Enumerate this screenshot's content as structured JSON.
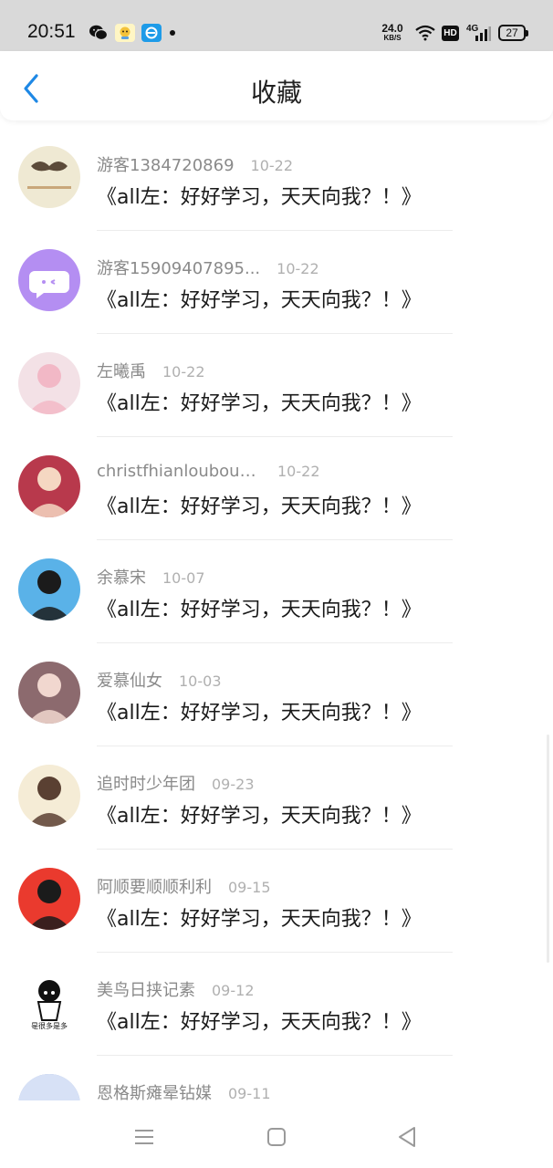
{
  "status_bar": {
    "time": "20:51",
    "net_speed_value": "24.0",
    "net_speed_unit": "KB/S",
    "hd_label": "HD",
    "network_label": "4G",
    "battery": "27",
    "notification_icons": [
      "wechat-icon",
      "contact-app-icon",
      "browser-app-icon"
    ]
  },
  "header": {
    "title": "收藏"
  },
  "favorites": [
    {
      "username": "游客1384720869",
      "date": "10-22",
      "content": "《all左：好好学习，天天向我？！》",
      "avatar_bg": "#efe9d3",
      "avatar_accent": "#5c4b3a"
    },
    {
      "username": "游客15909407895...",
      "date": "10-22",
      "content": "《all左：好好学习，天天向我？！》",
      "avatar_bg": "#b48ef2",
      "avatar_accent": "#ffffff"
    },
    {
      "username": "左曦禹",
      "date": "10-22",
      "content": "《all左：好好学习，天天向我？！》",
      "avatar_bg": "#f3e1e6",
      "avatar_accent": "#f2b8c6"
    },
    {
      "username": "christfhianloubout...",
      "date": "10-22",
      "content": "《all左：好好学习，天天向我？！》",
      "avatar_bg": "#b8394c",
      "avatar_accent": "#f5d7c2"
    },
    {
      "username": "余慕宋",
      "date": "10-07",
      "content": "《all左：好好学习，天天向我？！》",
      "avatar_bg": "#5ab2e8",
      "avatar_accent": "#1b1b1b"
    },
    {
      "username": "爱慕仙女",
      "date": "10-03",
      "content": "《all左：好好学习，天天向我？！》",
      "avatar_bg": "#8c6a6e",
      "avatar_accent": "#f1d7cf"
    },
    {
      "username": "追时时少年团",
      "date": "09-23",
      "content": "《all左：好好学习，天天向我？！》",
      "avatar_bg": "#f5ecd6",
      "avatar_accent": "#5a4032"
    },
    {
      "username": "阿顺要顺顺利利",
      "date": "09-15",
      "content": "《all左：好好学习，天天向我？！》",
      "avatar_bg": "#ea3a2e",
      "avatar_accent": "#1b1b1b"
    },
    {
      "username": "美鸟日挟记素",
      "date": "09-12",
      "content": "《all左：好好学习，天天向我？！》",
      "avatar_bg": "#ffffff",
      "avatar_accent": "#111111",
      "avatar_caption": "是很多是多"
    },
    {
      "username": "恩格斯瘫晕钻媒",
      "date": "09-11",
      "content": "",
      "avatar_bg": "#8ea9dc",
      "avatar_accent": "#d7e1f6"
    }
  ],
  "colors": {
    "accent": "#1e88e5",
    "status_bar_bg": "#d9d9d9",
    "username": "#8a8a8a",
    "date": "#b0b0b0",
    "content": "#1a1a1a"
  },
  "navigation": {
    "buttons": [
      "menu-icon",
      "home-icon",
      "back-icon"
    ]
  }
}
